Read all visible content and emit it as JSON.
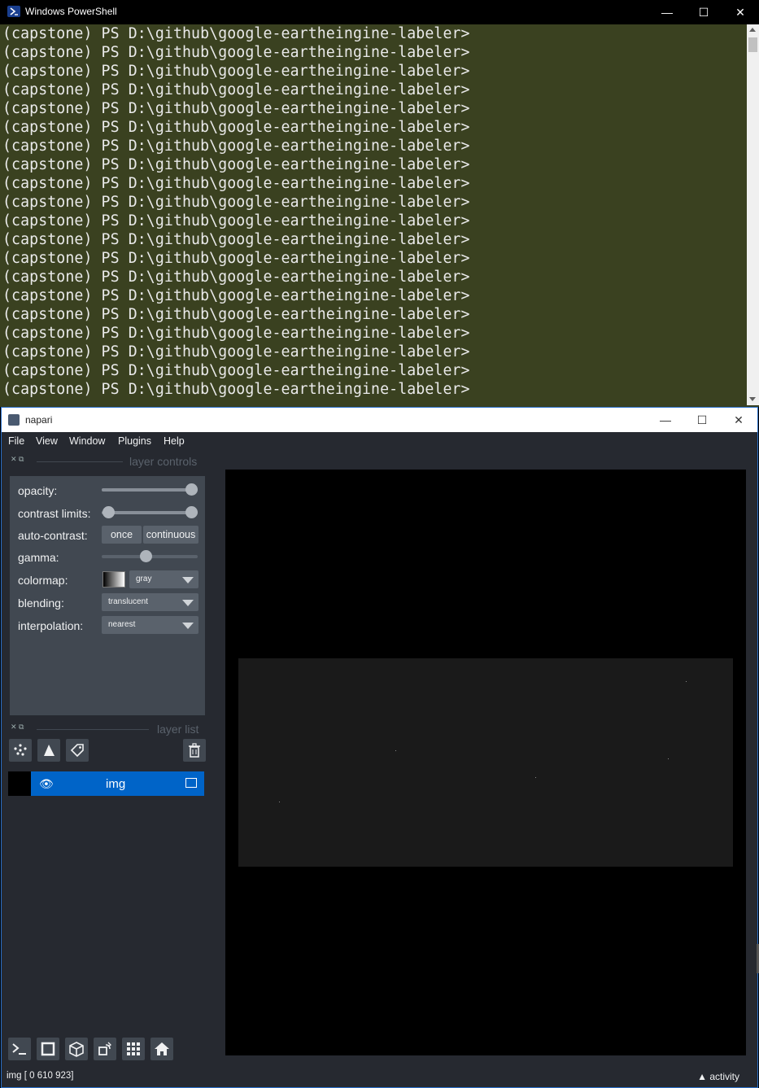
{
  "powershell": {
    "title": "Windows PowerShell",
    "controls": {
      "minimize": "—",
      "maximize": "☐",
      "close": "✕"
    },
    "lines": [
      "(capstone) PS D:\\github\\google-eartheingine-labeler>",
      "(capstone) PS D:\\github\\google-eartheingine-labeler>",
      "(capstone) PS D:\\github\\google-eartheingine-labeler>",
      "(capstone) PS D:\\github\\google-eartheingine-labeler>",
      "(capstone) PS D:\\github\\google-eartheingine-labeler>",
      "(capstone) PS D:\\github\\google-eartheingine-labeler>",
      "(capstone) PS D:\\github\\google-eartheingine-labeler>",
      "(capstone) PS D:\\github\\google-eartheingine-labeler>",
      "(capstone) PS D:\\github\\google-eartheingine-labeler>",
      "(capstone) PS D:\\github\\google-eartheingine-labeler>",
      "(capstone) PS D:\\github\\google-eartheingine-labeler>",
      "(capstone) PS D:\\github\\google-eartheingine-labeler>",
      "(capstone) PS D:\\github\\google-eartheingine-labeler>",
      "(capstone) PS D:\\github\\google-eartheingine-labeler>",
      "(capstone) PS D:\\github\\google-eartheingine-labeler>",
      "(capstone) PS D:\\github\\google-eartheingine-labeler>",
      "(capstone) PS D:\\github\\google-eartheingine-labeler>",
      "(capstone) PS D:\\github\\google-eartheingine-labeler>",
      "(capstone) PS D:\\github\\google-eartheingine-labeler>",
      "(capstone) PS D:\\github\\google-eartheingine-labeler>"
    ]
  },
  "napari": {
    "title": "napari",
    "controls": {
      "minimize": "—",
      "maximize": "☐",
      "close": "✕"
    },
    "menu": [
      "File",
      "View",
      "Window",
      "Plugins",
      "Help"
    ],
    "layer_controls": {
      "header": "layer controls",
      "opacity_label": "opacity:",
      "opacity_value": 1.0,
      "contrast_label": "contrast limits:",
      "autocontrast_label": "auto-contrast:",
      "once_button": "once",
      "continuous_button": "continuous",
      "gamma_label": "gamma:",
      "gamma_value": 0.45,
      "colormap_label": "colormap:",
      "colormap_value": "gray",
      "blending_label": "blending:",
      "blending_value": "translucent",
      "interpolation_label": "interpolation:",
      "interpolation_value": "nearest"
    },
    "layer_list": {
      "header": "layer list",
      "layers": [
        {
          "name": "img",
          "visible": true,
          "selected": true
        }
      ]
    },
    "status": "img [  0 610 923]",
    "activity": "activity",
    "colors": {
      "background": "#262930",
      "panel": "#414851",
      "selected_layer": "#0064c8",
      "powershell_bg": "#3a4120"
    }
  }
}
